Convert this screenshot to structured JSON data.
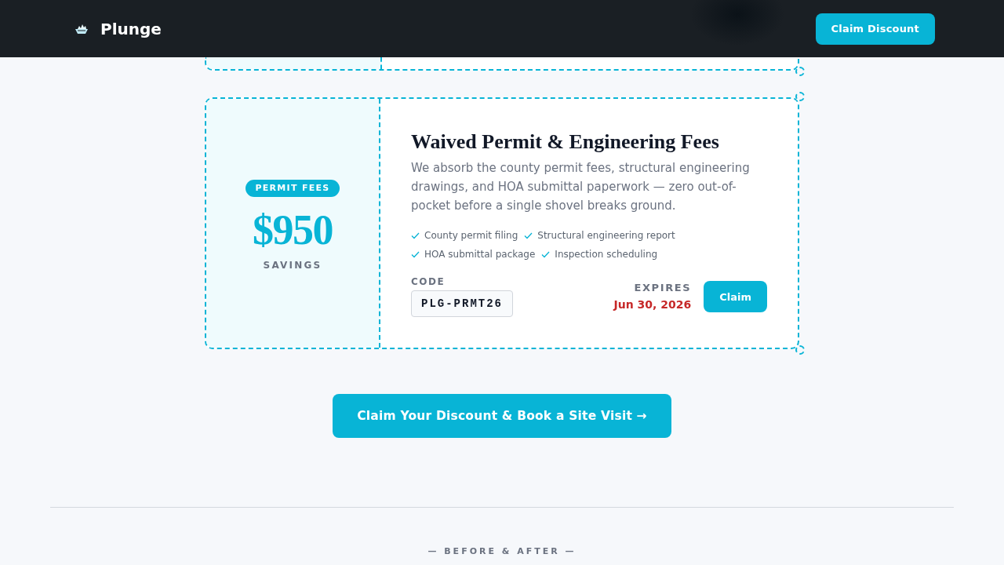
{
  "header": {
    "brand": "Plunge",
    "button": "Claim Discount"
  },
  "coupons": [
    {
      "kind": "clipped"
    },
    {
      "kind": "full",
      "badge": "PERMIT FEES",
      "amount": "$950",
      "amount_label": "SAVINGS",
      "title": "Waived Permit & Engineering Fees",
      "description": "We absorb the county permit fees, structural engineering drawings, and HOA submittal paperwork — zero out-of-pocket before a single shovel breaks ground.",
      "features": [
        "County permit filing",
        "Structural engineering report",
        "HOA submittal package",
        "Inspection scheduling"
      ],
      "code_label": "CODE",
      "code": "PLG-PRMT26",
      "expires_label": "EXPIRES",
      "expires": "Jun 30, 2026",
      "button": "Claim"
    }
  ],
  "cta": {
    "button": "Claim Your Discount & Book a Site Visit →"
  },
  "next_section": {
    "heading": "— BEFORE & AFTER —"
  }
}
